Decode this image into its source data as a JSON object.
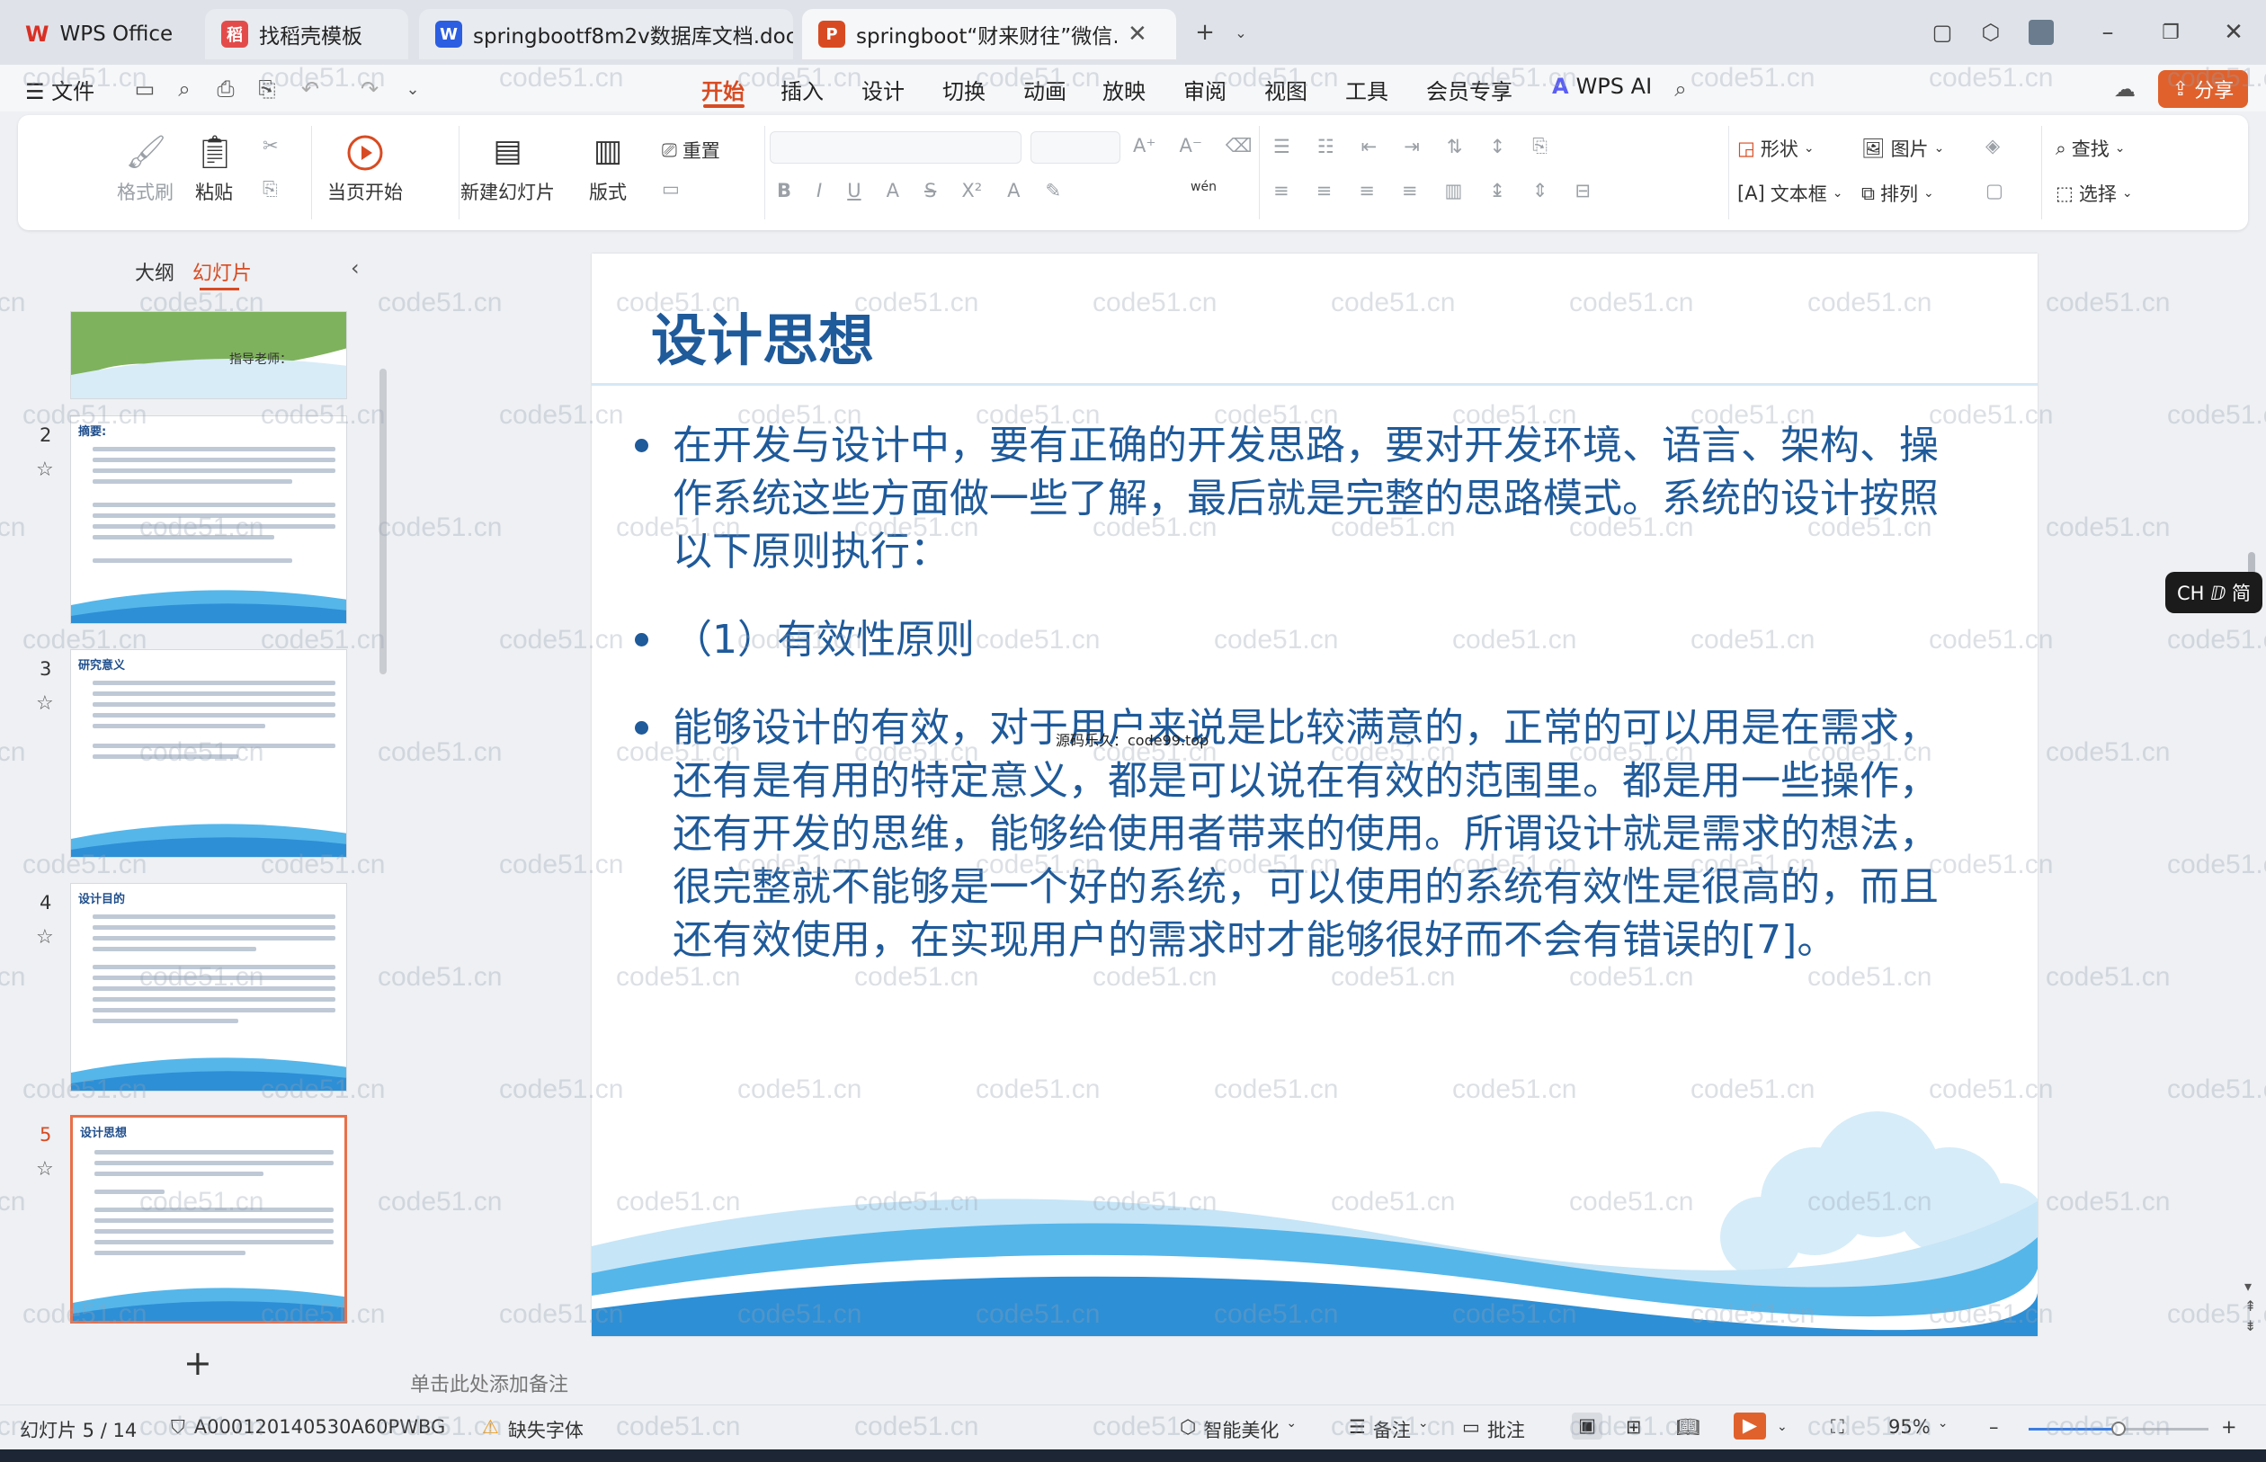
{
  "tabs": [
    {
      "label": "WPS Office",
      "icon": "wps-logo-icon",
      "color": "#d93025"
    },
    {
      "label": "找稻壳模板",
      "icon": "docer-icon",
      "color": "#e34b4b"
    },
    {
      "label": "springbootf8m2v数据库文档.doc",
      "icon": "word-doc-icon",
      "color": "#2b5ee1"
    },
    {
      "label": "springboot“财来财往”微信…",
      "icon": "ppt-doc-icon",
      "color": "#d84b22"
    }
  ],
  "menu": {
    "file": "文件",
    "tabs": [
      "开始",
      "插入",
      "设计",
      "切换",
      "动画",
      "放映",
      "审阅",
      "视图",
      "工具",
      "会员专享"
    ],
    "active_tab": "开始",
    "ai": "WPS AI",
    "share": "分享"
  },
  "ribbon": {
    "format_painter": "格式刷",
    "paste": "粘贴",
    "play_from_current": "当页开始",
    "new_slide": "新建幻灯片",
    "layout": "版式",
    "reset": "重置",
    "font_size_sample": "wén",
    "shape": "形状",
    "picture": "图片",
    "textbox": "文本框",
    "arrange": "排列",
    "find": "查找",
    "select": "选择"
  },
  "left_panel": {
    "outline_tab": "大纲",
    "slides_tab": "幻灯片",
    "thumbs": [
      {
        "num": "",
        "title": "指导老师："
      },
      {
        "num": "2",
        "title": "摘要:"
      },
      {
        "num": "3",
        "title": "研究意义"
      },
      {
        "num": "4",
        "title": "设计目的"
      },
      {
        "num": "5",
        "title": "设计思想"
      }
    ],
    "add_label": "+"
  },
  "slide": {
    "title": "设计思想",
    "bullets": [
      "在开发与设计中，要有正确的开发思路，要对开发环境、语言、架构、操作系统这些方面做一些了解，最后就是完整的思路模式。系统的设计按照以下原则执行：",
      "（1）有效性原则",
      "能够设计的有效，对于用户来说是比较满意的，正常的可以用是在需求，还有是有用的特定意义，都是可以说在有效的范围里。都是用一些操作，还有开发的思维，能够给使用者带来的使用。所谓设计就是需求的想法，很完整就不能够是一个好的系统，可以使用的系统有效性是很高的，而且还有效使用，在实现用户的需求时才能够很好而不会有错误的[7]。"
    ],
    "overlay": "源码乐久：code99.top"
  },
  "notes_placeholder": "单击此处添加备注",
  "status": {
    "slide_counter": "幻灯片 5 / 14",
    "doc_id": "A000120140530A60PWBG",
    "missing_font": "缺失字体",
    "beautify": "智能美化",
    "notes": "备注",
    "comments": "批注",
    "zoom": "95%"
  },
  "ime": "CH ⅅ 简",
  "watermark": "code51.cn"
}
